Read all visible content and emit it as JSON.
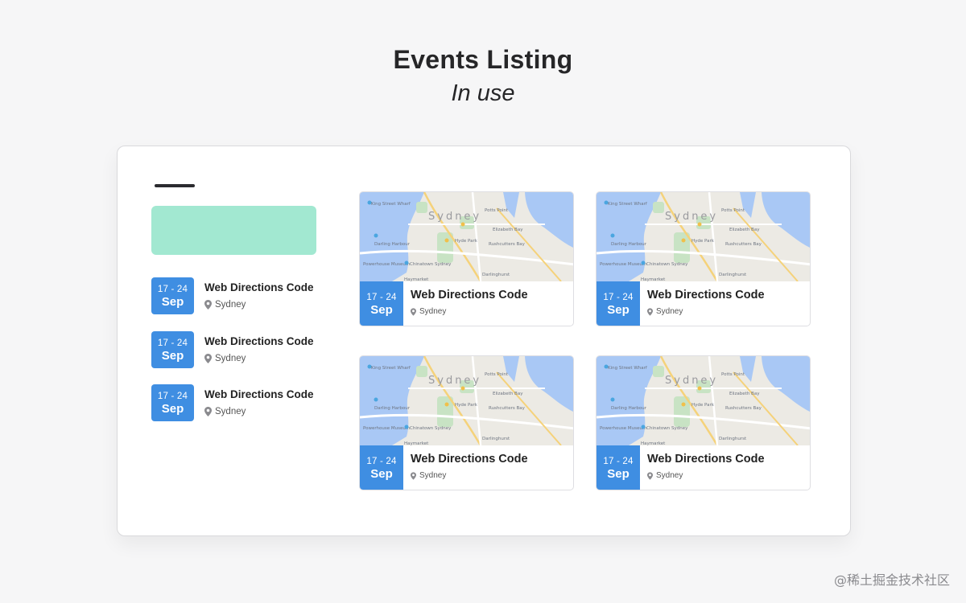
{
  "page": {
    "title": "Events Listing",
    "subtitle": "In use"
  },
  "sidebar": {
    "items": [
      {
        "date_range": "17 - 24",
        "month": "Sep",
        "title": "Web Directions Code",
        "location": "Sydney"
      },
      {
        "date_range": "17 - 24",
        "month": "Sep",
        "title": "Web Directions Code",
        "location": "Sydney"
      },
      {
        "date_range": "17 - 24",
        "month": "Sep",
        "title": "Web Directions Code",
        "location": "Sydney"
      }
    ]
  },
  "cards": [
    {
      "date_range": "17 - 24",
      "month": "Sep",
      "title": "Web Directions Code",
      "location": "Sydney",
      "map_city": "Sydney"
    },
    {
      "date_range": "17 - 24",
      "month": "Sep",
      "title": "Web Directions Code",
      "location": "Sydney",
      "map_city": "Sydney"
    },
    {
      "date_range": "17 - 24",
      "month": "Sep",
      "title": "Web Directions Code",
      "location": "Sydney",
      "map_city": "Sydney"
    },
    {
      "date_range": "17 - 24",
      "month": "Sep",
      "title": "Web Directions Code",
      "location": "Sydney",
      "map_city": "Sydney"
    }
  ],
  "map_labels": [
    "King Street Wharf",
    "Potts Point",
    "Elizabeth Bay",
    "Hyde Park",
    "Rushcutters Bay",
    "Darling Harbour",
    "Powerhouse Museum",
    "Chinatown Sydney",
    "Darlinghurst",
    "Haymarket"
  ],
  "colors": {
    "accent": "#3f8ee2",
    "banner": "#a2e8d1",
    "background": "#f6f6f7"
  },
  "watermark": "@稀土掘金技术社区"
}
